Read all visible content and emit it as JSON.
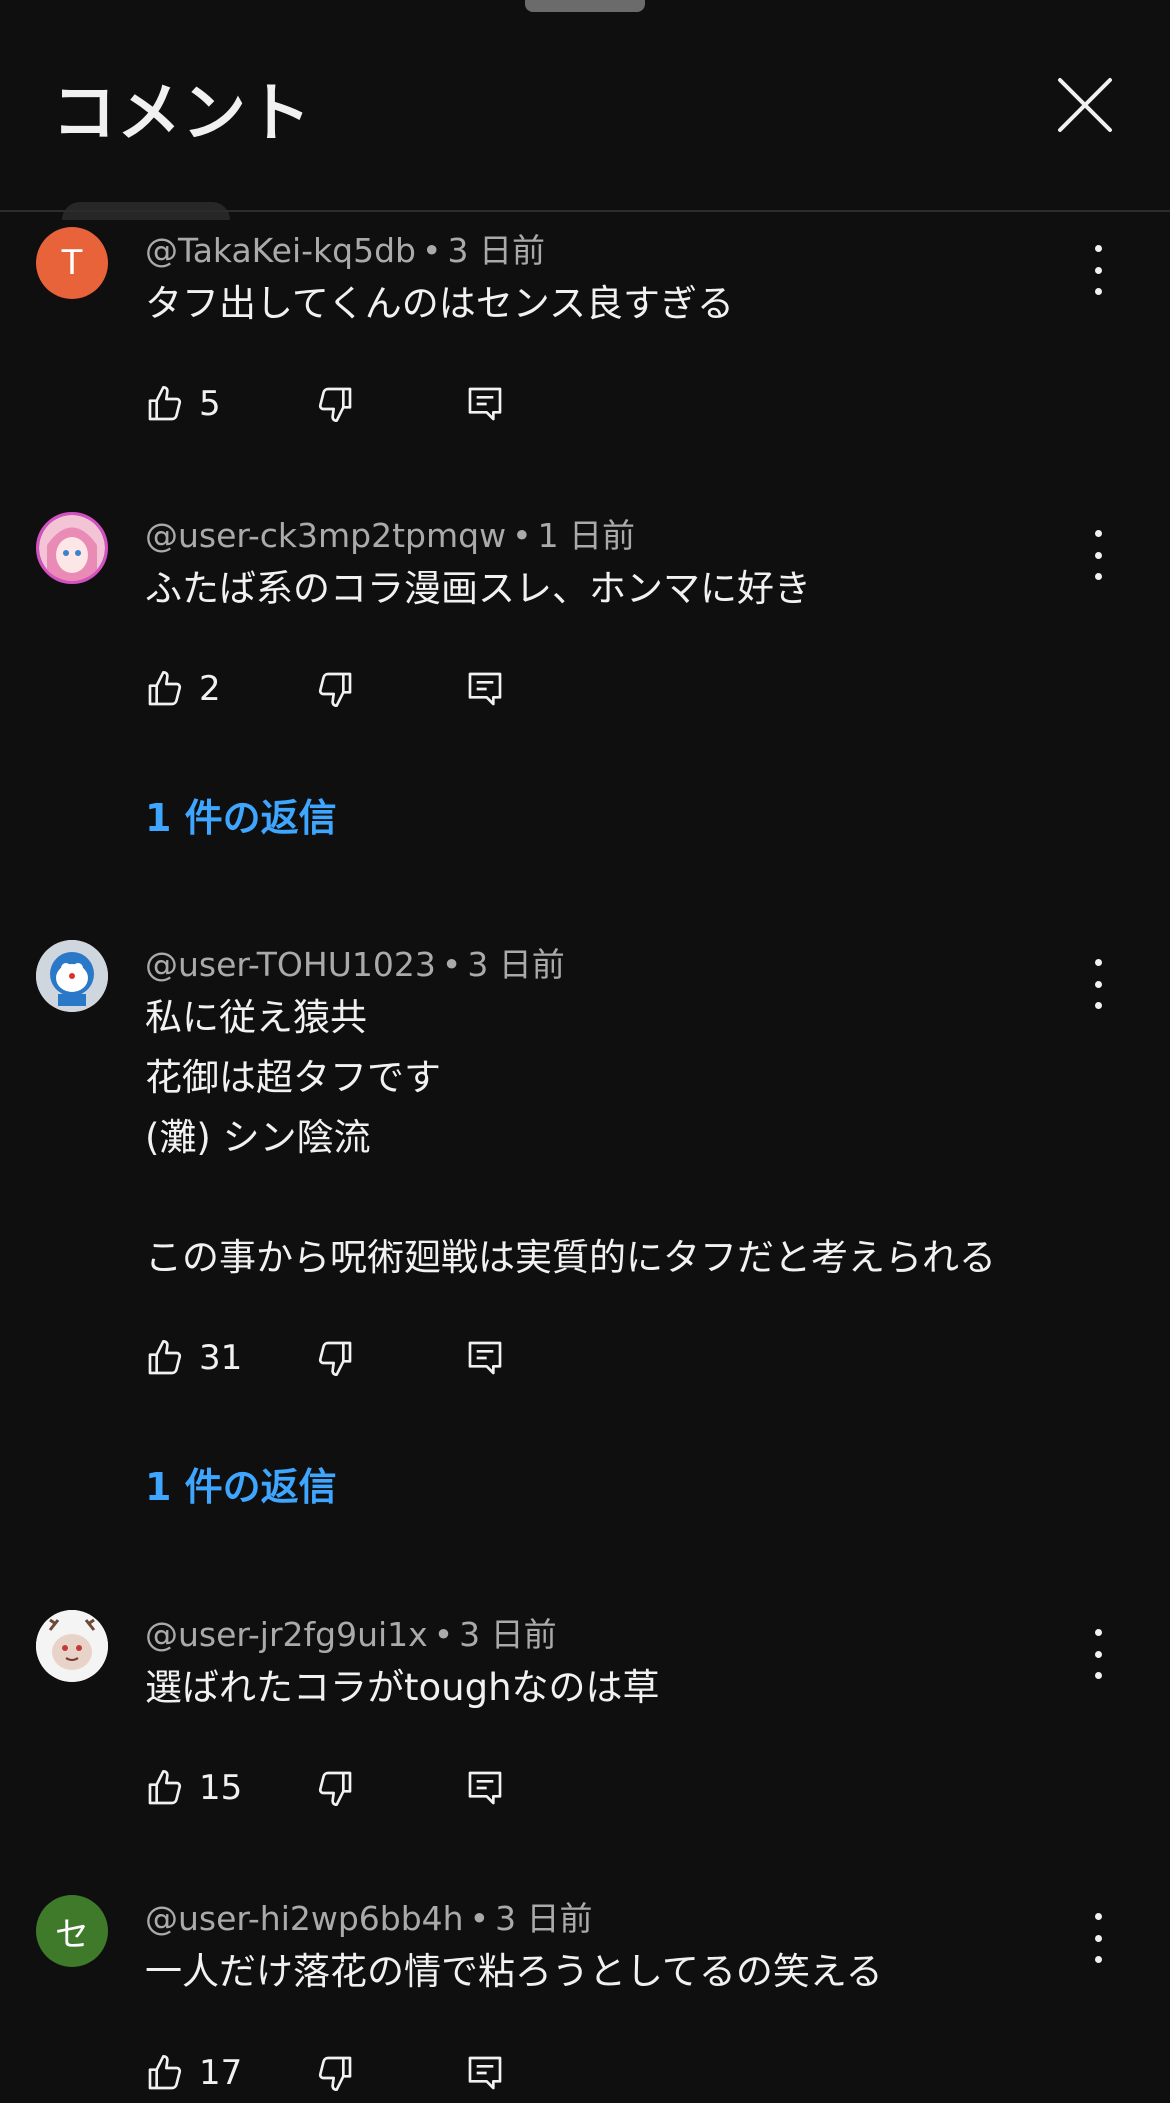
{
  "header": {
    "title": "コメント"
  },
  "comments": [
    {
      "author": "@TakaKei-kq5db",
      "age": "3 日前",
      "avatar_letter": "T",
      "avatar_color": "#e8623a",
      "text": "タフ出してくんのはセンス良すぎる",
      "likes": "5",
      "replies_label": ""
    },
    {
      "author": "@user-ck3mp2tpmqw",
      "age": "1 日前",
      "avatar_letter": "",
      "avatar_color": "#d64fc3",
      "text": "ふたば系のコラ漫画スレ、ホンマに好き",
      "likes": "2",
      "replies_label": "1 件の返信"
    },
    {
      "author": "@user-TOHU1023",
      "age": "3 日前",
      "avatar_letter": "",
      "avatar_color": "#d9dde3",
      "text": "私に従え猿共\n花御は超タフです\n(灘) シン陰流\n\nこの事から呪術廻戦は実質的にタフだと考えられる",
      "likes": "31",
      "replies_label": "1 件の返信"
    },
    {
      "author": "@user-jr2fg9ui1x",
      "age": "3 日前",
      "avatar_letter": "",
      "avatar_color": "#f2f2f2",
      "text": "選ばれたコラがtoughなのは草",
      "likes": "15",
      "replies_label": ""
    },
    {
      "author": "@user-hi2wp6bb4h",
      "age": "3 日前",
      "avatar_letter": "セ",
      "avatar_color": "#3e7a2a",
      "text": "一人だけ落花の情で粘ろうとしてるの笑える",
      "likes": "17",
      "replies_label": ""
    }
  ]
}
